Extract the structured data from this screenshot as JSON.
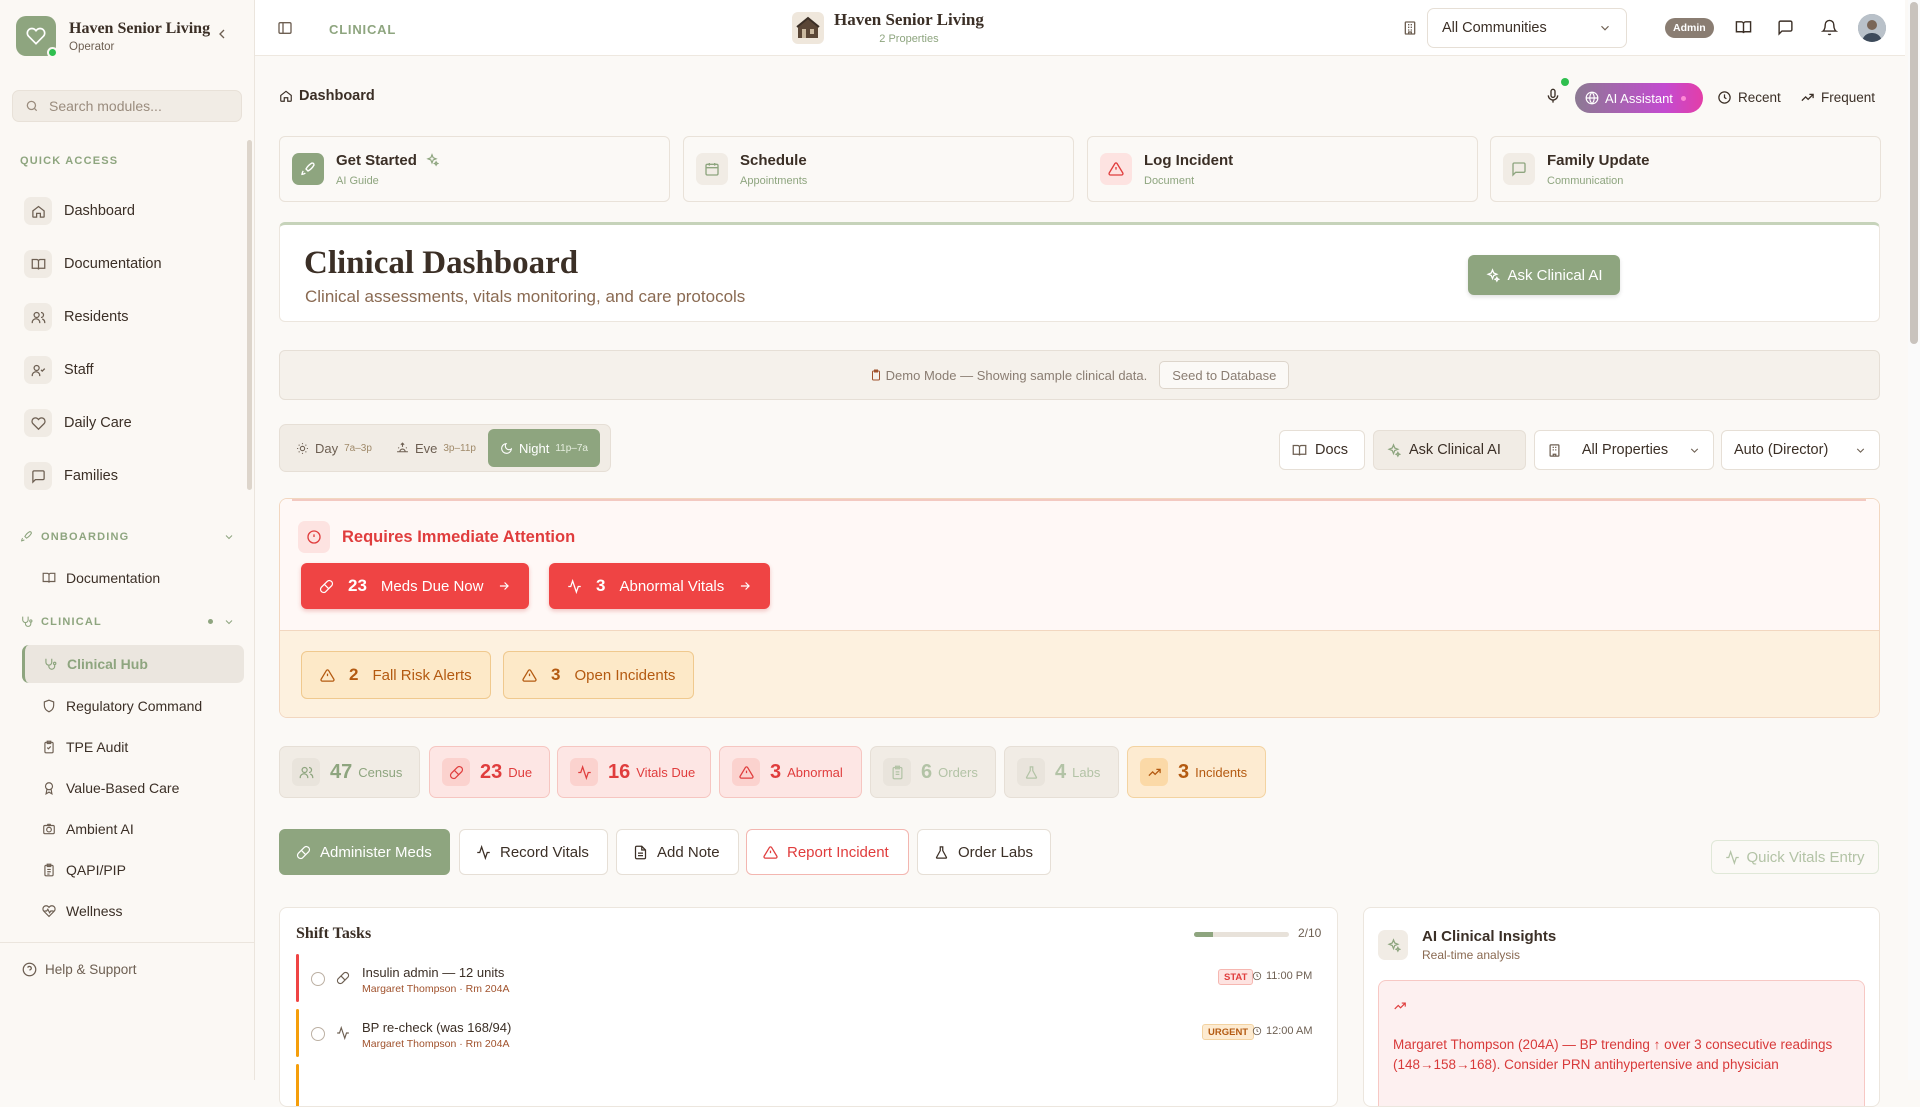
{
  "sidebar": {
    "brand_name": "Haven Senior Living",
    "brand_role": "Operator",
    "search_placeholder": "Search modules...",
    "quick_access_label": "QUICK ACCESS",
    "quick_access": [
      {
        "label": "Dashboard",
        "icon": "home-icon"
      },
      {
        "label": "Documentation",
        "icon": "book-icon"
      },
      {
        "label": "Residents",
        "icon": "users-icon"
      },
      {
        "label": "Staff",
        "icon": "user-check-icon"
      },
      {
        "label": "Daily Care",
        "icon": "heart-icon"
      },
      {
        "label": "Families",
        "icon": "message-icon"
      }
    ],
    "onboarding_label": "ONBOARDING",
    "onboarding_items": [
      {
        "label": "Documentation",
        "icon": "book-icon"
      }
    ],
    "clinical_label": "CLINICAL",
    "clinical_items": [
      {
        "label": "Clinical Hub",
        "icon": "stethoscope-icon",
        "active": true
      },
      {
        "label": "Regulatory Command",
        "icon": "shield-icon"
      },
      {
        "label": "TPE Audit",
        "icon": "clipboard-icon"
      },
      {
        "label": "Value-Based Care",
        "icon": "award-icon"
      },
      {
        "label": "Ambient AI",
        "icon": "camera-icon"
      },
      {
        "label": "QAPI/PIP",
        "icon": "clipboard-list-icon"
      },
      {
        "label": "Wellness",
        "icon": "heart-pulse-icon"
      }
    ],
    "help_label": "Help & Support"
  },
  "topbar": {
    "crumb": "CLINICAL",
    "org_name": "Haven Senior Living",
    "org_sub": "2 Properties",
    "community_select": "All Communities",
    "admin_badge": "Admin"
  },
  "header": {
    "breadcrumb": "Dashboard",
    "ai_assistant": "AI Assistant",
    "recent": "Recent",
    "frequent": "Frequent"
  },
  "quick_cards": [
    {
      "title": "Get Started",
      "sub": "AI Guide"
    },
    {
      "title": "Schedule",
      "sub": "Appointments"
    },
    {
      "title": "Log Incident",
      "sub": "Document"
    },
    {
      "title": "Family Update",
      "sub": "Communication"
    }
  ],
  "hero": {
    "title": "Clinical Dashboard",
    "subtitle": "Clinical assessments, vitals monitoring, and care protocols",
    "cta": "Ask Clinical AI"
  },
  "demo": {
    "text": "Demo Mode — Showing sample clinical data.",
    "seed": "Seed to Database"
  },
  "shifts": [
    {
      "label": "Day",
      "hours": "7a–3p",
      "active": false
    },
    {
      "label": "Eve",
      "hours": "3p–11p",
      "active": false
    },
    {
      "label": "Night",
      "hours": "11p–7a",
      "active": true
    }
  ],
  "controls": {
    "docs": "Docs",
    "ask": "Ask Clinical AI",
    "properties": "All Properties",
    "role": "Auto (Director)"
  },
  "attention": {
    "title": "Requires Immediate Attention",
    "urgent": [
      {
        "count": "23",
        "label": "Meds Due Now"
      },
      {
        "count": "3",
        "label": "Abnormal Vitals"
      }
    ],
    "warnings": [
      {
        "count": "2",
        "label": "Fall Risk Alerts"
      },
      {
        "count": "3",
        "label": "Open Incidents"
      }
    ]
  },
  "stats": [
    {
      "value": "47",
      "label": "Census"
    },
    {
      "value": "23",
      "label": "Due"
    },
    {
      "value": "16",
      "label": "Vitals Due"
    },
    {
      "value": "3",
      "label": "Abnormal"
    },
    {
      "value": "6",
      "label": "Orders"
    },
    {
      "value": "4",
      "label": "Labs"
    },
    {
      "value": "3",
      "label": "Incidents"
    }
  ],
  "actions": {
    "administer": "Administer Meds",
    "vitals": "Record Vitals",
    "note": "Add Note",
    "incident": "Report Incident",
    "labs": "Order Labs",
    "quick_vitals": "Quick Vitals Entry"
  },
  "tasks": {
    "title": "Shift Tasks",
    "progress_text": "2/10",
    "progress_fraction": 0.2,
    "items": [
      {
        "title": "Insulin admin — 12 units",
        "sub": "Margaret Thompson · Rm 204A",
        "badge": "STAT",
        "time": "11:00 PM"
      },
      {
        "title": "BP re-check (was 168/94)",
        "sub": "Margaret Thompson · Rm 204A",
        "badge": "URGENT",
        "time": "12:00 AM"
      }
    ]
  },
  "insights": {
    "title": "AI Clinical Insights",
    "sub": "Real-time analysis",
    "card_text": "Margaret Thompson (204A) — BP trending ↑ over 3 consecutive readings (148→158→168). Consider PRN antihypertensive and physician"
  },
  "colors": {
    "accent": "#8ea57f",
    "danger": "#ef4444",
    "warning": "#b45a11",
    "text": "#3b2f26"
  }
}
